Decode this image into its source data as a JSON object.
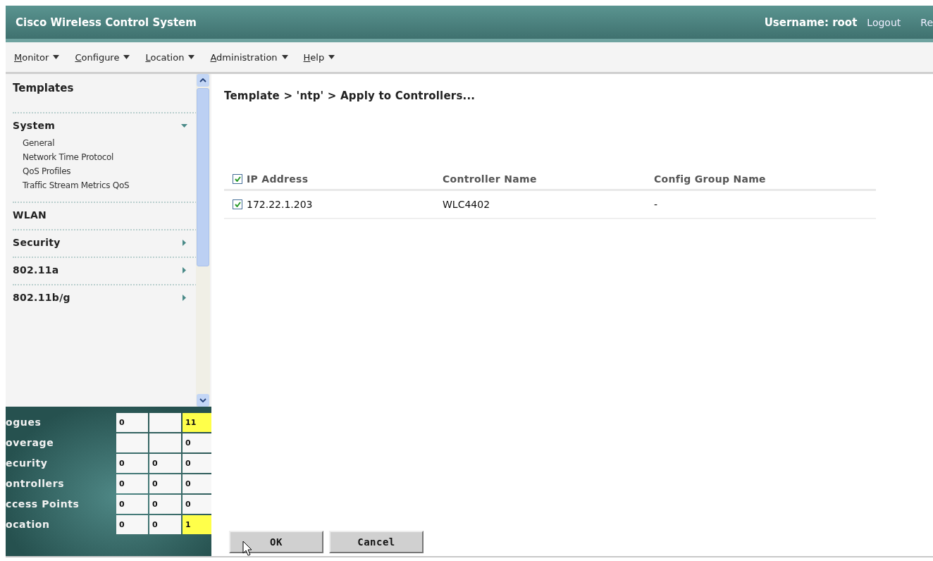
{
  "header": {
    "title": "Cisco Wireless Control System",
    "user": "Username: root",
    "links": [
      "Logout",
      "Re"
    ]
  },
  "menu": [
    {
      "label": "Monitor"
    },
    {
      "label": "Configure"
    },
    {
      "label": "Location"
    },
    {
      "label": "Administration"
    },
    {
      "label": "Help"
    }
  ],
  "sidebar": {
    "title": "Templates",
    "items": [
      {
        "label": "System",
        "kind": "folder",
        "expanded": true,
        "children": [
          {
            "label": "General"
          },
          {
            "label": "Network Time Protocol"
          },
          {
            "label": "QoS Profiles"
          },
          {
            "label": "Traffic Stream Metrics QoS"
          }
        ]
      },
      {
        "label": "WLAN",
        "kind": "link"
      },
      {
        "label": "Security",
        "kind": "folder",
        "expanded": false
      },
      {
        "label": "802.11a",
        "kind": "folder",
        "expanded": false
      },
      {
        "label": "802.11b/g",
        "kind": "folder",
        "expanded": false
      }
    ]
  },
  "alarms": [
    {
      "label": "ogues",
      "cells": [
        {
          "value": "0",
          "alert": false
        },
        {
          "alert": false
        },
        {
          "value": "11",
          "alert": true
        }
      ]
    },
    {
      "label": "overage",
      "cells": [
        {
          "alert": false
        },
        {
          "alert": false
        },
        {
          "value": "0",
          "alert": false
        }
      ]
    },
    {
      "label": "ecurity",
      "cells": [
        {
          "value": "0",
          "alert": false
        },
        {
          "value": "0",
          "alert": false
        },
        {
          "value": "0",
          "alert": false
        }
      ]
    },
    {
      "label": "ontrollers",
      "cells": [
        {
          "value": "0",
          "alert": false
        },
        {
          "value": "0",
          "alert": false
        },
        {
          "value": "0",
          "alert": false
        }
      ]
    },
    {
      "label": "ccess Points",
      "cells": [
        {
          "value": "0",
          "alert": false
        },
        {
          "value": "0",
          "alert": false
        },
        {
          "value": "0",
          "alert": false
        }
      ]
    },
    {
      "label": "ocation",
      "cells": [
        {
          "value": "0",
          "alert": false
        },
        {
          "value": "0",
          "alert": false
        },
        {
          "value": "1",
          "alert": true
        }
      ]
    }
  ],
  "breadcrumb": "Template > 'ntp' > Apply to Controllers...",
  "table": {
    "select_all": true,
    "columns": [
      "IP Address",
      "Controller Name",
      "Config Group Name"
    ],
    "rows": [
      {
        "checked": true,
        "cells": [
          "172.22.1.203",
          "WLC4402",
          "-"
        ]
      }
    ]
  },
  "buttons": [
    "OK",
    "Cancel"
  ]
}
